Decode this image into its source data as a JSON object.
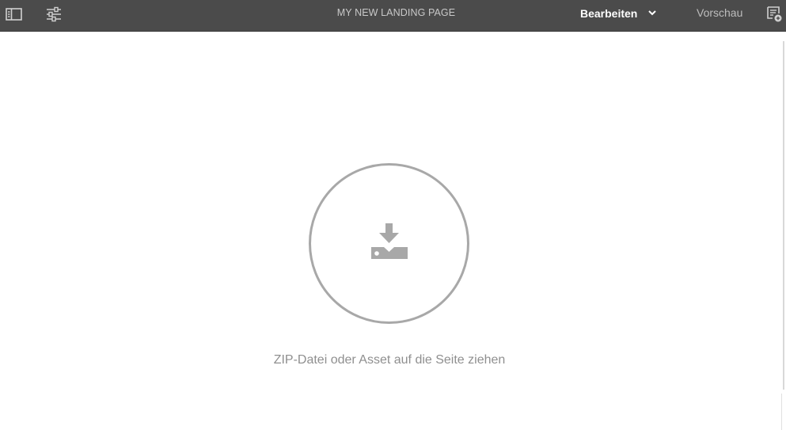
{
  "header": {
    "title": "MY NEW LANDING PAGE",
    "mode_label": "Bearbeiten",
    "preview_label": "Vorschau"
  },
  "icons": {
    "side_panel": "side-panel-toggle-icon",
    "properties": "page-properties-sliders-icon",
    "mode_dropdown": "chevron-down-icon",
    "annotations": "annotations-icon",
    "drop_zone": "download-tray-icon"
  },
  "dropzone": {
    "instruction": "ZIP-Datei oder Asset auf die Seite ziehen"
  },
  "colors": {
    "toolbar_bg": "#4b4b4b",
    "title_text": "#c9c9c9",
    "drop_circle": "#a8a8a8",
    "drop_text": "#8f8f8f"
  }
}
